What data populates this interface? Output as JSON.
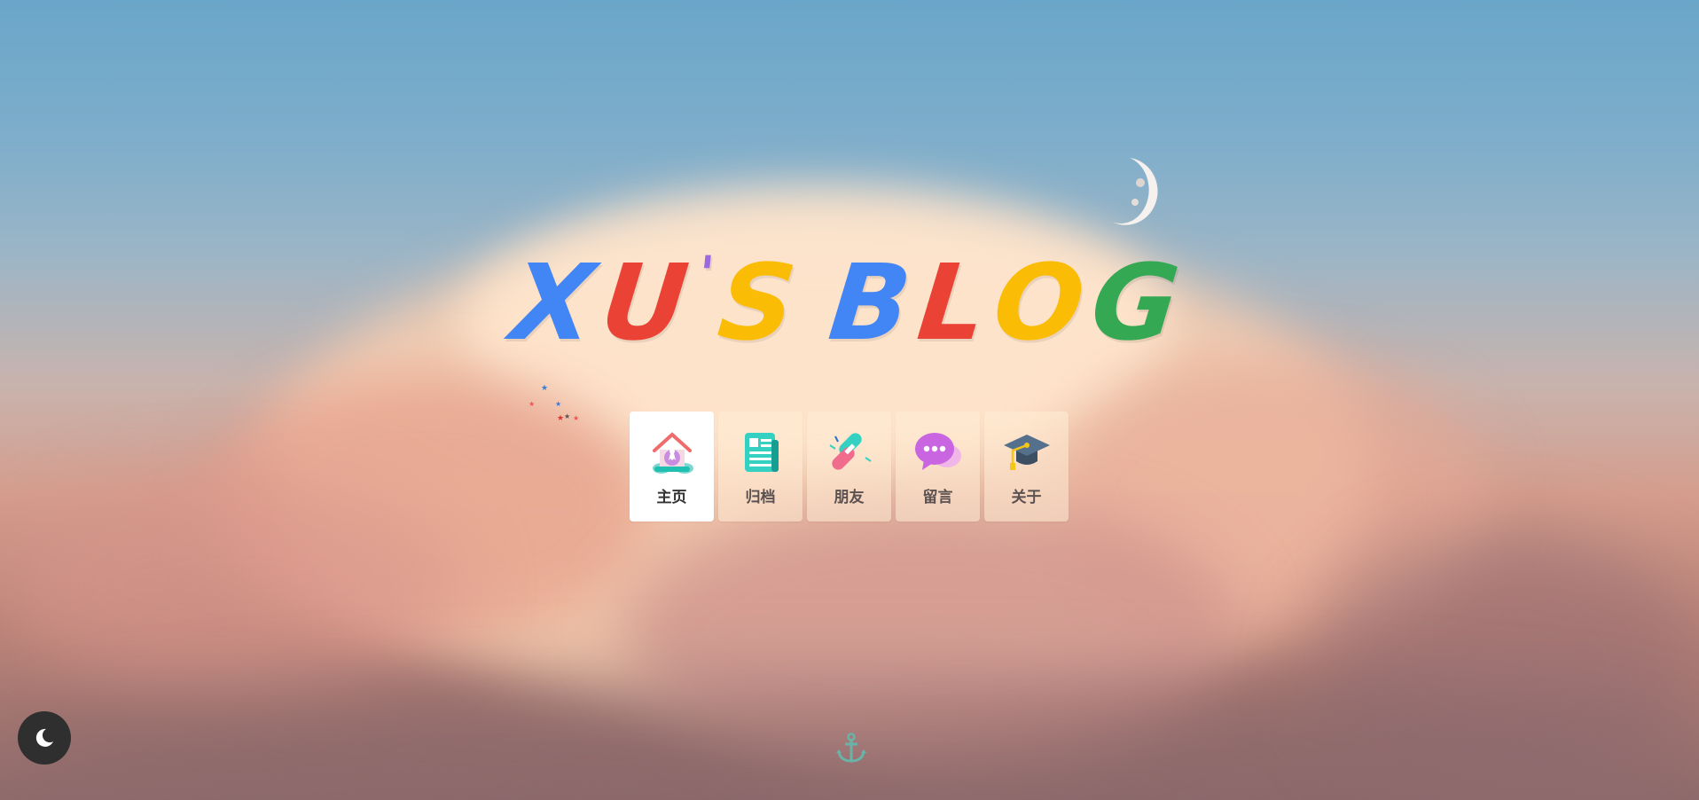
{
  "blog": {
    "title_letters": [
      "X",
      "U",
      "'",
      "S",
      " ",
      "B",
      "L",
      "O",
      "G"
    ],
    "letter_colors": [
      "#4285f4",
      "#ea4335",
      "#9c6ade",
      "#fbbc05",
      "",
      "#4285f4",
      "#ea4335",
      "#fbbc05",
      "#34a853"
    ]
  },
  "nav": {
    "items": [
      {
        "label": "主页",
        "icon": "home-icon",
        "active": true
      },
      {
        "label": "归档",
        "icon": "archive-icon",
        "active": false
      },
      {
        "label": "朋友",
        "icon": "link-icon",
        "active": false
      },
      {
        "label": "留言",
        "icon": "message-icon",
        "active": false
      },
      {
        "label": "关于",
        "icon": "graduation-cap-icon",
        "active": false
      }
    ]
  },
  "controls": {
    "theme_toggle_icon": "moon-icon",
    "scroll_down_icon": "anchor-icon"
  }
}
